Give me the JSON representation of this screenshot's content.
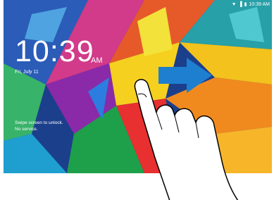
{
  "status_bar": {
    "time": "10:39 AM",
    "icons": [
      "wifi-icon",
      "signal-icon",
      "battery-icon"
    ]
  },
  "lockscreen": {
    "time": "10:39",
    "ampm": "AM",
    "date": "Fri, July 11",
    "hint_line1": "Swipe screen to unlock.",
    "hint_line2": "No service."
  },
  "gesture": {
    "arrow_color": "#1e7fd0",
    "arrow_direction": "right",
    "hand_icon": "pointing-hand-icon"
  }
}
